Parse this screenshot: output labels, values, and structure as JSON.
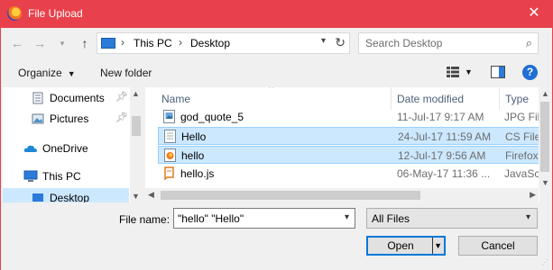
{
  "window": {
    "title": "File Upload",
    "accent_color": "#e8414c"
  },
  "nav": {
    "address": [
      "This PC",
      "Desktop"
    ],
    "search_placeholder": "Search Desktop"
  },
  "toolbar": {
    "organize_label": "Organize",
    "new_folder_label": "New folder"
  },
  "sidebar": {
    "items": [
      {
        "label": "Documents",
        "icon": "documents-icon",
        "pinned": true
      },
      {
        "label": "Pictures",
        "icon": "pictures-icon",
        "pinned": true
      },
      {
        "label": "OneDrive",
        "icon": "onedrive-icon",
        "pinned": false
      },
      {
        "label": "This PC",
        "icon": "this-pc-icon",
        "pinned": false
      },
      {
        "label": "Desktop",
        "icon": "desktop-icon",
        "pinned": false,
        "selected": true
      }
    ]
  },
  "filelist": {
    "columns": [
      "Name",
      "Date modified",
      "Type"
    ],
    "rows": [
      {
        "name": "god_quote_5",
        "date": "11-Jul-17 9:17 AM",
        "type": "JPG File",
        "icon": "image-file-icon",
        "selected": false
      },
      {
        "name": "Hello",
        "date": "24-Jul-17 11:59 AM",
        "type": "CS File",
        "icon": "cs-file-icon",
        "selected": true
      },
      {
        "name": "hello",
        "date": "12-Jul-17 9:56 AM",
        "type": "Firefox",
        "icon": "firefox-html-icon",
        "selected": true
      },
      {
        "name": "hello.js",
        "date": "06-May-17 11:36 ...",
        "type": "JavaSc",
        "icon": "js-file-icon",
        "selected": false
      }
    ]
  },
  "footer": {
    "file_name_label": "File name:",
    "file_name_value": "\"hello\" \"Hello\"",
    "filter_value": "All Files",
    "open_label": "Open",
    "cancel_label": "Cancel"
  }
}
